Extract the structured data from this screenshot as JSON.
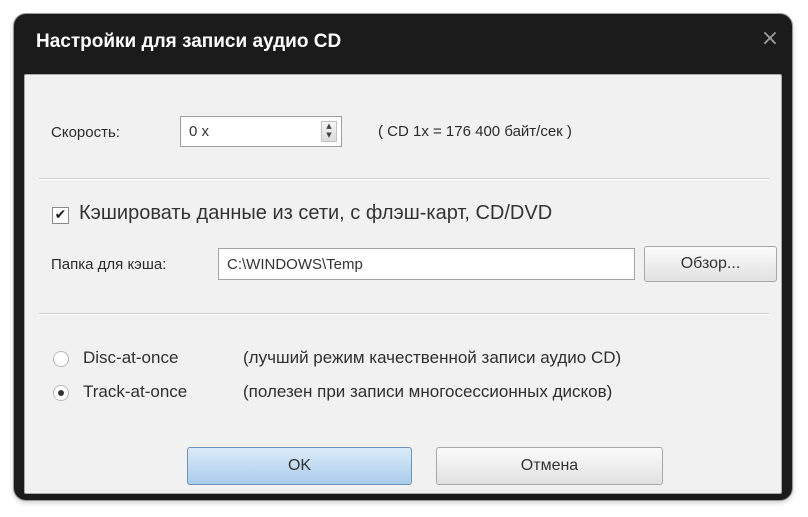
{
  "window": {
    "title": "Настройки для записи аудио CD",
    "close_glyph": "×"
  },
  "speed": {
    "label": "Скорость:",
    "value": "0 x",
    "note": "( CD 1x = 176 400 байт/сек )"
  },
  "cache": {
    "checked": true,
    "check_glyph": "✔",
    "label": "Кэшировать данные из сети, с флэш-карт, CD/DVD",
    "folder_label": "Папка для кэша:",
    "folder_value": "C:\\WINDOWS\\Temp",
    "browse_label": "Обзор..."
  },
  "modes": [
    {
      "name": "Disc-at-once",
      "description": "(лучший режим качественной записи аудио CD)",
      "selected": false
    },
    {
      "name": "Track-at-once",
      "description": "(полезен при записи многосессионных дисков)",
      "selected": true
    }
  ],
  "buttons": {
    "ok_label": "OK",
    "cancel_label": "Отмена"
  },
  "icons": {
    "close": "close-icon",
    "spin": "spin-arrows-icon",
    "check": "checkmark-icon"
  },
  "colors": {
    "titlebar": "#1b1b1b",
    "body": "#f1f1f1",
    "ok_button": "#a9cbea"
  }
}
